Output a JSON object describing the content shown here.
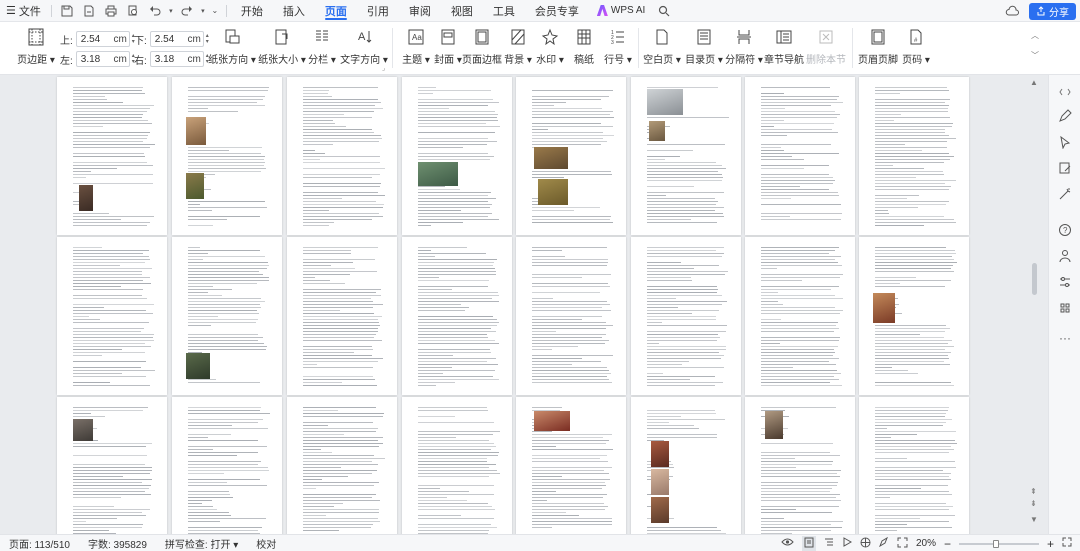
{
  "menubar": {
    "menu_label": "文件",
    "tabs": [
      "开始",
      "插入",
      "页面",
      "引用",
      "审阅",
      "视图",
      "工具",
      "会员专享"
    ],
    "active_tab": "页面",
    "wps_ai": "WPS AI",
    "share": "分享"
  },
  "ribbon": {
    "margins": {
      "top_label": "上:",
      "top_value": "2.54",
      "bottom_label": "下:",
      "bottom_value": "2.54",
      "left_label": "左:",
      "left_value": "3.18",
      "right_label": "右:",
      "right_value": "3.18",
      "unit": "cm"
    },
    "page_margin": "页边距",
    "paper_direction": "纸张方向",
    "paper_size": "纸张大小",
    "columns": "分栏",
    "text_direction": "文字方向",
    "theme": "主题",
    "cover": "封面",
    "page_border": "页面边框",
    "background": "背景",
    "watermark": "水印",
    "manuscript": "稿纸",
    "line_number": "行号",
    "blank_page": "空白页",
    "toc_page": "目录页",
    "separator": "分隔符",
    "chapter_nav": "章节导航",
    "delete_chapter": "删除本节",
    "header_footer": "页眉页脚",
    "page_number": "页码"
  },
  "status": {
    "page": "页面: 113/510",
    "words": "字数: 395829",
    "spell": "拼写检查: 打开",
    "proof": "校对",
    "zoom": "20%",
    "zoom_fraction": 0.2
  },
  "colors": {
    "accent": "#2a6ff0"
  }
}
